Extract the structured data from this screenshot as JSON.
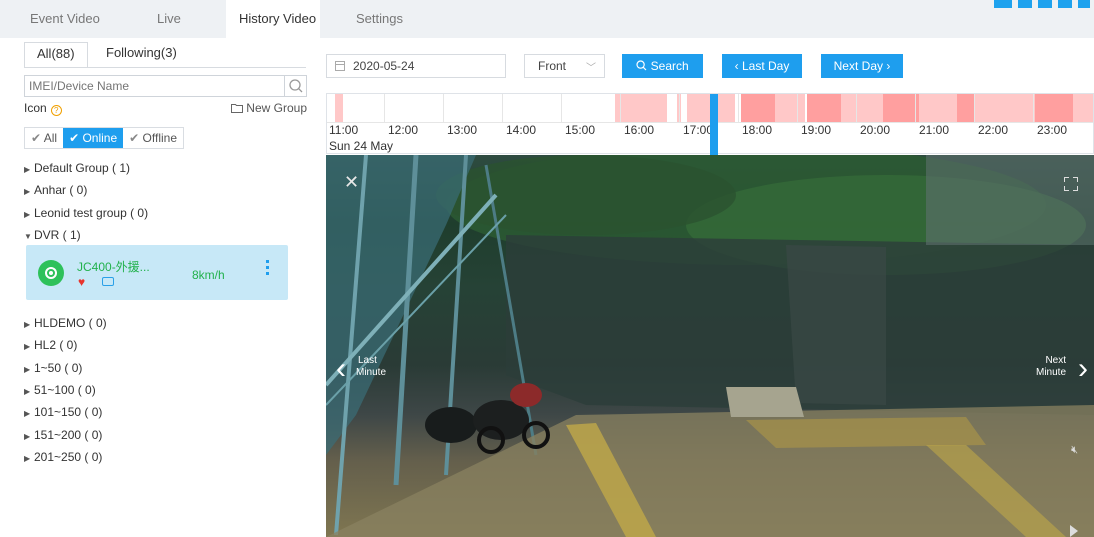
{
  "top_tabs": [
    "Event Video",
    "Live",
    "History Video",
    "Settings"
  ],
  "sidebar": {
    "subtabs": [
      "All(88)",
      "Following(3)"
    ],
    "search_placeholder": "IMEI/Device Name",
    "icon_label": "Icon",
    "help_symbol": "?",
    "new_group": "New Group",
    "filters": [
      "All",
      "Online",
      "Offline"
    ],
    "groups_top": [
      "Default Group ( 1)",
      "Anhar ( 0)",
      "Leonid test group ( 0)",
      "DVR ( 1)"
    ],
    "device": {
      "name": "JC400-外援...",
      "speed": "8km/h"
    },
    "groups_bottom": [
      "HLDEMO ( 0)",
      "HL2 ( 0)",
      "1~50 ( 0)",
      "51~100 ( 0)",
      "101~150 ( 0)",
      "151~200 ( 0)",
      "201~250 ( 0)"
    ]
  },
  "controls": {
    "date": "2020-05-24",
    "camera": "Front",
    "search": "Search",
    "last_day": "Last Day",
    "next_day": "Next Day"
  },
  "timeline": {
    "hours": [
      "11:00",
      "12:00",
      "13:00",
      "14:00",
      "15:00",
      "16:00",
      "17:00",
      "18:00",
      "19:00",
      "20:00",
      "21:00",
      "22:00",
      "23:00"
    ],
    "day_label": "Sun 24 May",
    "colors": {
      "recorded_light": "#ffc8c8",
      "recorded_dark": "#ff9f9f",
      "cursor": "#1e9eee"
    }
  },
  "video": {
    "last_minute": [
      "Last",
      "Minute"
    ],
    "next_minute": [
      "Next",
      "Minute"
    ]
  },
  "accent": "#1e9eee"
}
